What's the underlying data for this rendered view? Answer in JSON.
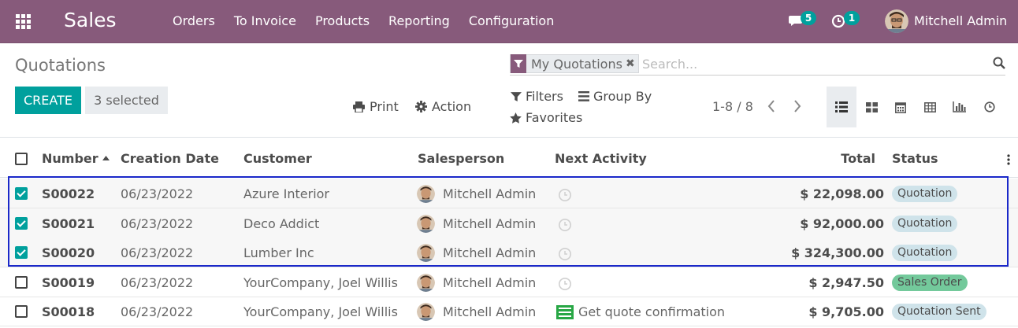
{
  "navbar": {
    "app_name": "Sales",
    "menu": [
      "Orders",
      "To Invoice",
      "Products",
      "Reporting",
      "Configuration"
    ],
    "messages_count": "5",
    "activities_count": "1",
    "user_name": "Mitchell Admin",
    "icons": {
      "apps": "apps-grid-icon",
      "messages": "chat-icon",
      "activities": "clock-icon"
    }
  },
  "control_panel": {
    "title": "Quotations",
    "create_label": "CREATE",
    "selected_label": "3 selected",
    "print_label": "Print",
    "action_label": "Action",
    "search": {
      "facet_label": "My Quotations",
      "placeholder": "Search..."
    },
    "filters_label": "Filters",
    "group_by_label": "Group By",
    "favorites_label": "Favorites",
    "pager": "1-8 / 8",
    "views": [
      "list",
      "kanban",
      "calendar",
      "pivot",
      "graph",
      "activity"
    ],
    "active_view": "list"
  },
  "table": {
    "columns": [
      "Number",
      "Creation Date",
      "Customer",
      "Salesperson",
      "Next Activity",
      "Total",
      "Status"
    ],
    "sort_column": "Number",
    "rows": [
      {
        "number": "S00022",
        "date": "06/23/2022",
        "customer": "Azure Interior",
        "salesperson": "Mitchell Admin",
        "activity": "",
        "total": "$ 22,098.00",
        "status": "Quotation",
        "selected": true
      },
      {
        "number": "S00021",
        "date": "06/23/2022",
        "customer": "Deco Addict",
        "salesperson": "Mitchell Admin",
        "activity": "",
        "total": "$ 92,000.00",
        "status": "Quotation",
        "selected": true
      },
      {
        "number": "S00020",
        "date": "06/23/2022",
        "customer": "Lumber Inc",
        "salesperson": "Mitchell Admin",
        "activity": "",
        "total": "$ 324,300.00",
        "status": "Quotation",
        "selected": true
      },
      {
        "number": "S00019",
        "date": "06/23/2022",
        "customer": "YourCompany, Joel Willis",
        "salesperson": "Mitchell Admin",
        "activity": "",
        "total": "$ 2,947.50",
        "status": "Sales Order",
        "selected": false
      },
      {
        "number": "S00018",
        "date": "06/23/2022",
        "customer": "YourCompany, Joel Willis",
        "salesperson": "Mitchell Admin",
        "activity": "Get quote confirmation",
        "total": "$ 9,705.00",
        "status": "Quotation Sent",
        "selected": false
      }
    ]
  },
  "colors": {
    "brand": "#875a7b",
    "primary": "#00a09d",
    "highlight": "#1a28c9"
  }
}
